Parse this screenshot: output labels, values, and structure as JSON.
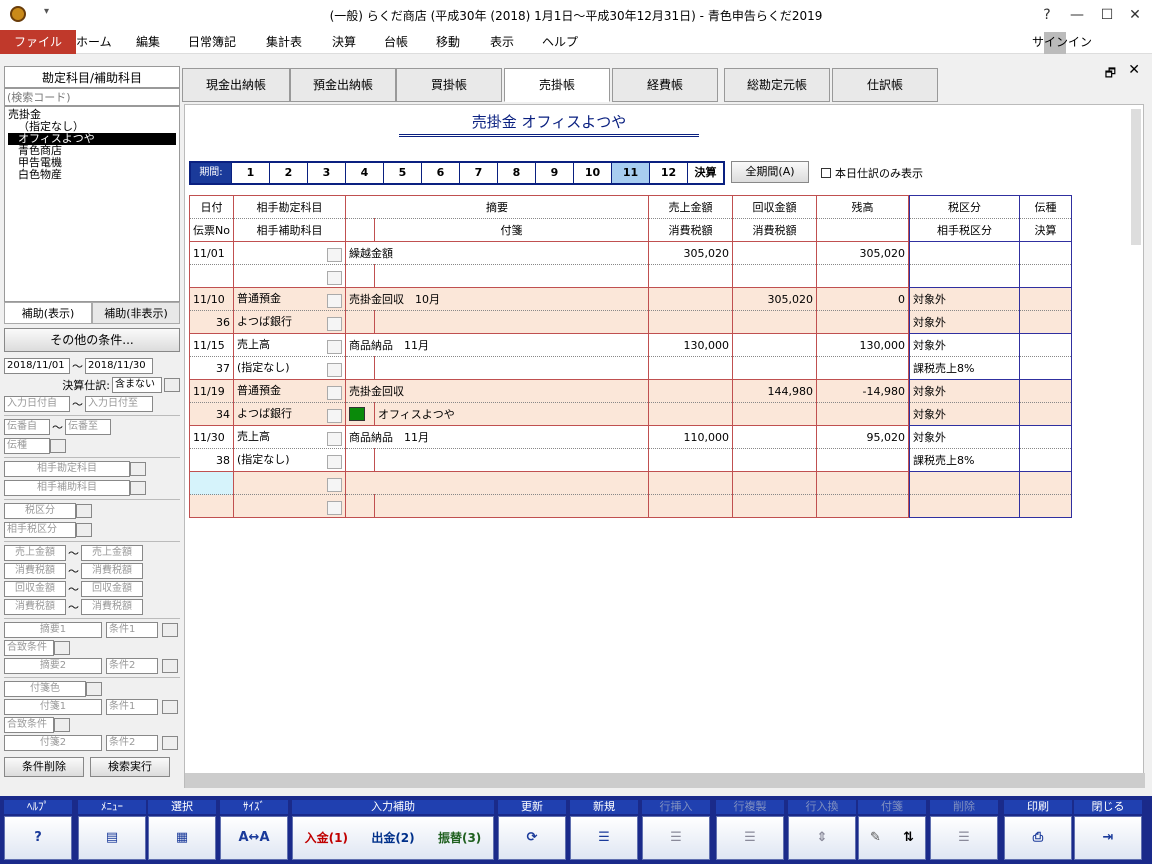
{
  "window": {
    "title": "(一般) らくだ商店 (平成30年 (2018) 1月1日～平成30年12月31日) - 青色申告らくだ2019",
    "help": "?",
    "minimize": "—",
    "maximize": "☐",
    "close": "✕"
  },
  "menu": {
    "items": [
      "ファイル",
      "ホーム",
      "編集",
      "日常簿記",
      "集計表",
      "決算",
      "台帳",
      "移動",
      "表示",
      "ヘルプ"
    ],
    "signin": "サインイン"
  },
  "left": {
    "header": "勘定科目/補助科目",
    "search_placeholder": "(検索コード)",
    "accounts": [
      "売掛金",
      "（指定なし）",
      "オフィスよつや",
      "青色商店",
      "甲告電機",
      "白色物産"
    ],
    "tab_show": "補助(表示)",
    "tab_hide": "補助(非表示)",
    "other_conditions": "その他の条件...",
    "date_from": "2018/11/01",
    "date_to": "2018/11/30",
    "tilde": "～",
    "settle_label": "決算仕訳:",
    "settle_value": "含まない",
    "input_from": "入力日付自",
    "input_to": "入力日付至",
    "slip_from": "伝番自",
    "slip_to": "伝番至",
    "slip_type": "伝種",
    "counter_acct": "相手勘定科目",
    "counter_sub": "相手補助科目",
    "tax_kind": "税区分",
    "counter_tax": "相手税区分",
    "sales_amt": "売上金額",
    "tax_amt": "消費税額",
    "collect_amt": "回収金額",
    "memo1": "摘要1",
    "cond1": "条件1",
    "match_cond": "合致条件",
    "memo2": "摘要2",
    "cond2": "条件2",
    "sticky_color": "付箋色",
    "sticky1": "付箋1",
    "sticky2": "付箋2",
    "clear_btn": "条件削除",
    "search_btn": "検索実行"
  },
  "tabs": [
    "現金出納帳",
    "預金出納帳",
    "買掛帳",
    "売掛帳",
    "経費帳",
    "総勘定元帳",
    "仕訳帳"
  ],
  "active_tab": 3,
  "ledger": {
    "title": "売掛金 オフィスよつや",
    "period_label": "期間:",
    "periods": [
      "1",
      "2",
      "3",
      "4",
      "5",
      "6",
      "7",
      "8",
      "9",
      "10",
      "11",
      "12",
      "決算"
    ],
    "active_period": 10,
    "all_period_btn": "全期間(A)",
    "today_only": "本日仕訳のみ表示",
    "headers": {
      "date": "日付",
      "slipno": "伝票No",
      "acct": "相手勘定科目",
      "sub": "相手補助科目",
      "memo": "摘要",
      "sticky": "付箋",
      "sales": "売上金額",
      "salestax": "消費税額",
      "collect": "回収金額",
      "collecttax": "消費税額",
      "balance": "残高",
      "tax": "税区分",
      "countertax": "相手税区分",
      "slipkind": "伝種",
      "settle": "決算"
    },
    "rows": [
      {
        "date": "11/01",
        "no": "",
        "acct": "",
        "sub": "",
        "memo": "繰越金額",
        "sticky": "",
        "sales": "305,020",
        "collect": "",
        "balance": "305,020",
        "tax1": "",
        "tax2": "",
        "tint": false,
        "flag": false
      },
      {
        "date": "11/10",
        "no": "36",
        "acct": "普通預金",
        "sub": "よつば銀行",
        "memo": "売掛金回収　10月",
        "sticky": "",
        "sales": "",
        "collect": "305,020",
        "balance": "0",
        "tax1": "対象外",
        "tax2": "対象外",
        "tint": true,
        "flag": false
      },
      {
        "date": "11/15",
        "no": "37",
        "acct": "売上高",
        "sub": "(指定なし)",
        "memo": "商品納品　11月",
        "sticky": "",
        "sales": "130,000",
        "collect": "",
        "balance": "130,000",
        "tax1": "対象外",
        "tax2": "課税売上8%",
        "tint": false,
        "flag": false
      },
      {
        "date": "11/19",
        "no": "34",
        "acct": "普通預金",
        "sub": "よつば銀行",
        "memo": "売掛金回収",
        "sticky": "オフィスよつや",
        "sales": "",
        "collect": "144,980",
        "balance": "-14,980",
        "tax1": "対象外",
        "tax2": "対象外",
        "tint": true,
        "flag": true
      },
      {
        "date": "11/30",
        "no": "38",
        "acct": "売上高",
        "sub": "(指定なし)",
        "memo": "商品納品　11月",
        "sticky": "",
        "sales": "110,000",
        "collect": "",
        "balance": "95,020",
        "tax1": "対象外",
        "tax2": "課税売上8%",
        "tint": false,
        "flag": false
      },
      {
        "date": "",
        "no": "",
        "acct": "",
        "sub": "",
        "memo": "",
        "sticky": "",
        "sales": "",
        "collect": "",
        "balance": "",
        "tax1": "",
        "tax2": "",
        "tint": true,
        "flag": false,
        "cursor": true
      }
    ]
  },
  "toolbar": [
    {
      "label": "ﾍﾙﾌﾟ",
      "body": "?",
      "enabled": true
    },
    {
      "label": "ﾒﾆｭｰ",
      "body": "▤",
      "enabled": true
    },
    {
      "label": "選択",
      "body": "▦",
      "enabled": true
    },
    {
      "label": "ｻｲｽﾞ",
      "body": "A↔A",
      "enabled": true
    },
    {
      "label": "入力補助",
      "body": "",
      "enabled": true
    },
    {
      "label": "更新",
      "body": "⟳",
      "enabled": true
    },
    {
      "label": "新規",
      "body": "☰",
      "enabled": true
    },
    {
      "label": "行挿入",
      "body": "☰",
      "enabled": false
    },
    {
      "label": "行複製",
      "body": "☰",
      "enabled": false
    },
    {
      "label": "行入換",
      "body": "⇕",
      "enabled": false
    },
    {
      "label": "付箋",
      "body": "",
      "enabled": false
    },
    {
      "label": "削除",
      "body": "☰",
      "enabled": false
    },
    {
      "label": "印刷",
      "body": "⎙",
      "enabled": true
    },
    {
      "label": "閉じる",
      "body": "⇥",
      "enabled": true
    }
  ],
  "assist": {
    "deposit": "入金(1)",
    "payment": "出金(2)",
    "transfer": "振替(3)"
  }
}
